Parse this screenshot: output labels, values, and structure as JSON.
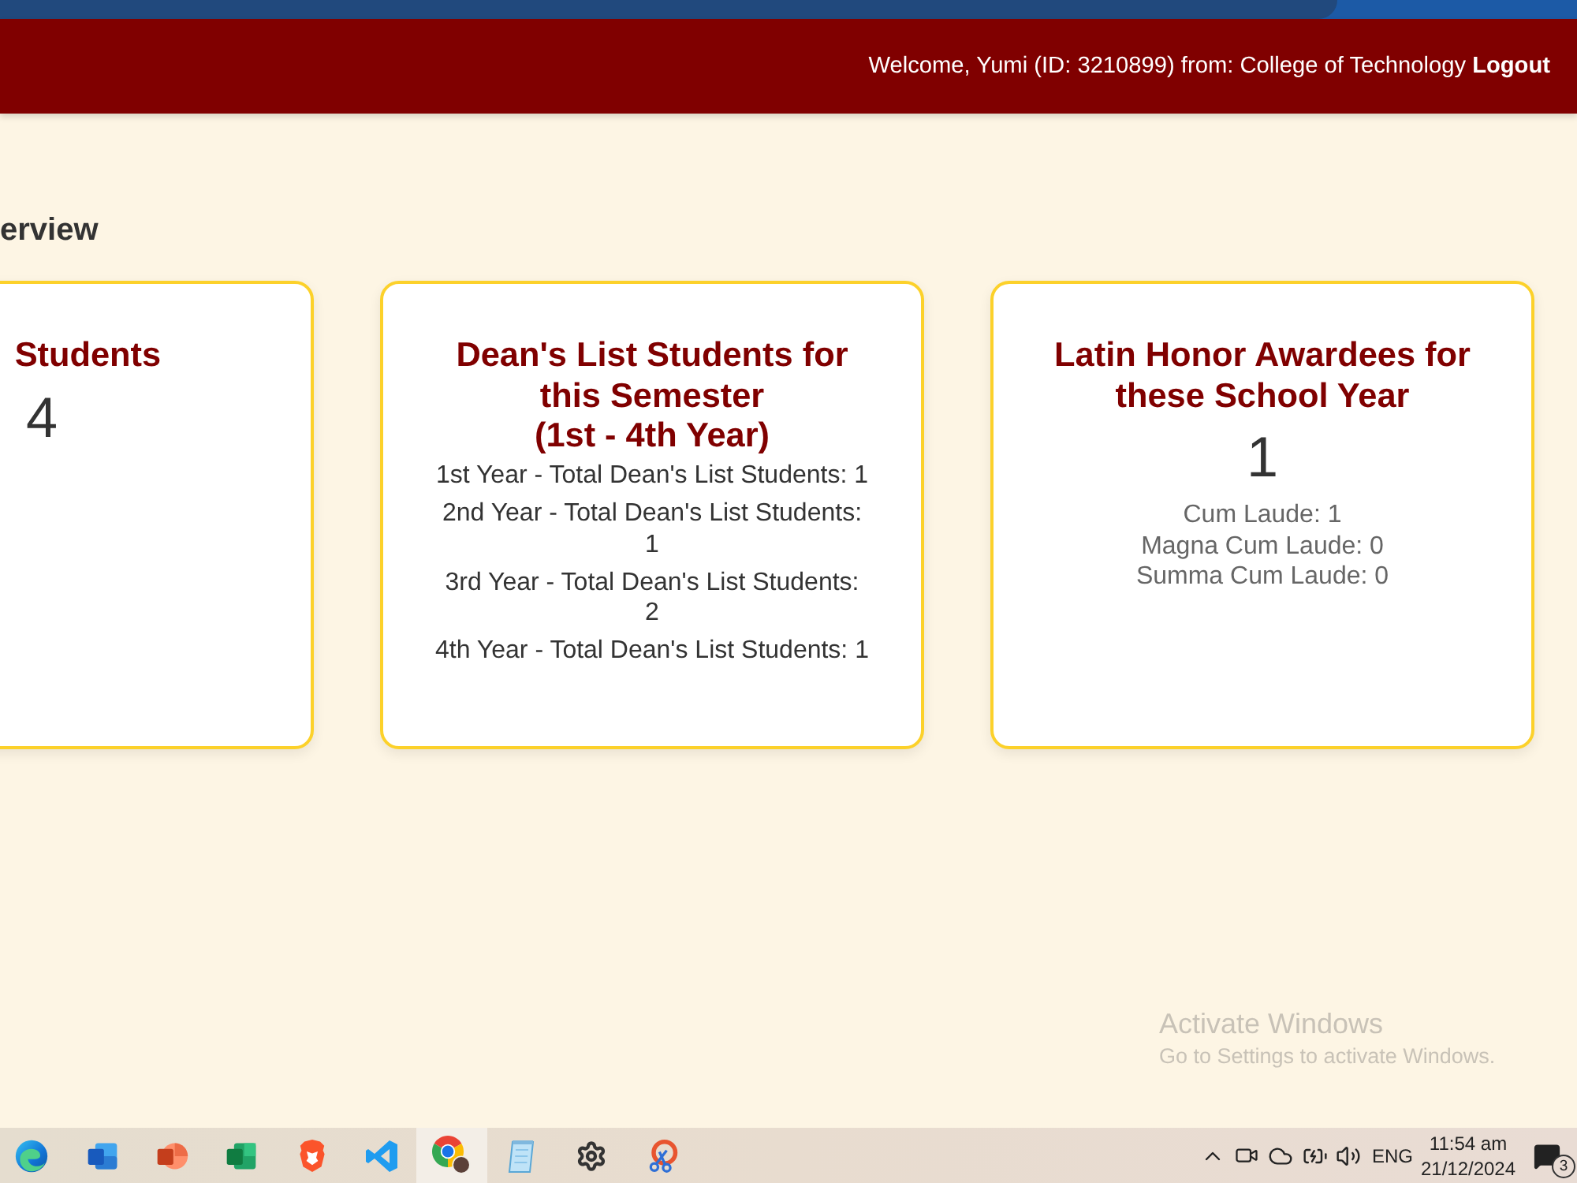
{
  "header": {
    "welcome": "Welcome, Yumi (ID: 3210899) from: College of Technology",
    "logout": "Logout"
  },
  "page": {
    "heading": "erview",
    "cards": [
      {
        "kind": "count",
        "title": "Students",
        "value": "4"
      },
      {
        "kind": "list",
        "title": "Dean's List Students for this Semester",
        "subtitle": "(1st - 4th Year)",
        "items": [
          "1st Year - Total Dean's List Students: 1",
          "2nd Year - Total Dean's List Students: 1",
          "3rd Year - Total Dean's List Students: 2",
          "4th Year - Total Dean's List Students: 1"
        ]
      },
      {
        "kind": "honors",
        "title": "Latin Honor Awardees for these School Year",
        "value": "1",
        "items": [
          "Cum Laude: 1",
          "Magna Cum Laude: 0",
          "Summa Cum Laude: 0"
        ]
      }
    ]
  },
  "os_notice": {
    "title": "Activate Windows",
    "text": "Go to Settings to activate Windows."
  },
  "taskbar": {
    "apps": [
      {
        "kind": "swirl",
        "active": false
      },
      {
        "kind": "doc",
        "active": false
      },
      {
        "kind": "slides",
        "active": false
      },
      {
        "kind": "sheet",
        "active": false
      },
      {
        "kind": "shield",
        "active": false
      },
      {
        "kind": "ribbon",
        "active": false
      },
      {
        "kind": "wheel",
        "active": true
      },
      {
        "kind": "notepad",
        "active": false
      },
      {
        "kind": "gear",
        "active": false
      },
      {
        "kind": "scissors",
        "active": false
      }
    ],
    "language": "ENG",
    "time": "11:54 am",
    "date": "21/12/2024",
    "notifications": "3"
  }
}
